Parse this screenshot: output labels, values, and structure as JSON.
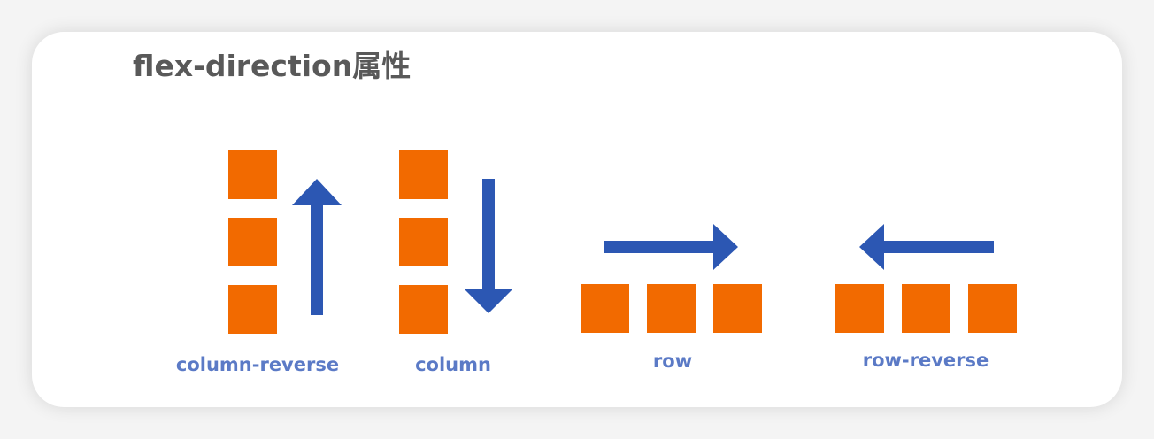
{
  "title": "flex-direction属性",
  "colors": {
    "square": "#f26a00",
    "arrow": "#2c57b3",
    "label": "#5b7ac6",
    "title": "#595959"
  },
  "diagrams": [
    {
      "label": "column-reverse",
      "arrow": "up"
    },
    {
      "label": "column",
      "arrow": "down"
    },
    {
      "label": "row",
      "arrow": "right"
    },
    {
      "label": "row-reverse",
      "arrow": "left"
    }
  ]
}
